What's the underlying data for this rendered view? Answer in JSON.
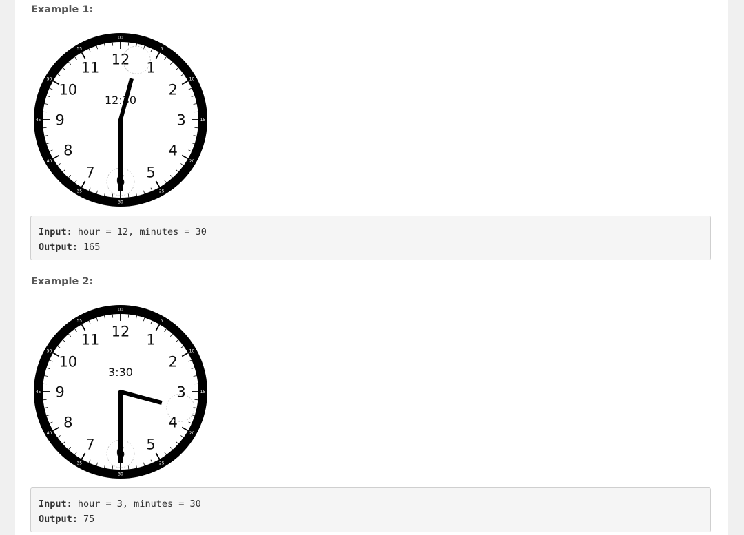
{
  "examples": [
    {
      "heading": "Example 1:",
      "clock": {
        "hour": 12,
        "minutes": 30,
        "time_label": "12:30",
        "hour_numbers": [
          "12",
          "1",
          "2",
          "3",
          "4",
          "5",
          "6",
          "7",
          "8",
          "9",
          "10",
          "11"
        ],
        "minute_labels": [
          "00",
          "5",
          "10",
          "15",
          "20",
          "25",
          "30",
          "35",
          "40",
          "45",
          "50",
          "55"
        ]
      },
      "input_label": "Input:",
      "input_text": " hour = 12, minutes = 30",
      "output_label": "Output:",
      "output_text": " 165"
    },
    {
      "heading": "Example 2:",
      "clock": {
        "hour": 3,
        "minutes": 30,
        "time_label": "3:30",
        "hour_numbers": [
          "12",
          "1",
          "2",
          "3",
          "4",
          "5",
          "6",
          "7",
          "8",
          "9",
          "10",
          "11"
        ],
        "minute_labels": [
          "00",
          "5",
          "10",
          "15",
          "20",
          "25",
          "30",
          "35",
          "40",
          "45",
          "50",
          "55"
        ]
      },
      "input_label": "Input:",
      "input_text": " hour = 3, minutes = 30",
      "output_label": "Output:",
      "output_text": " 75"
    }
  ]
}
